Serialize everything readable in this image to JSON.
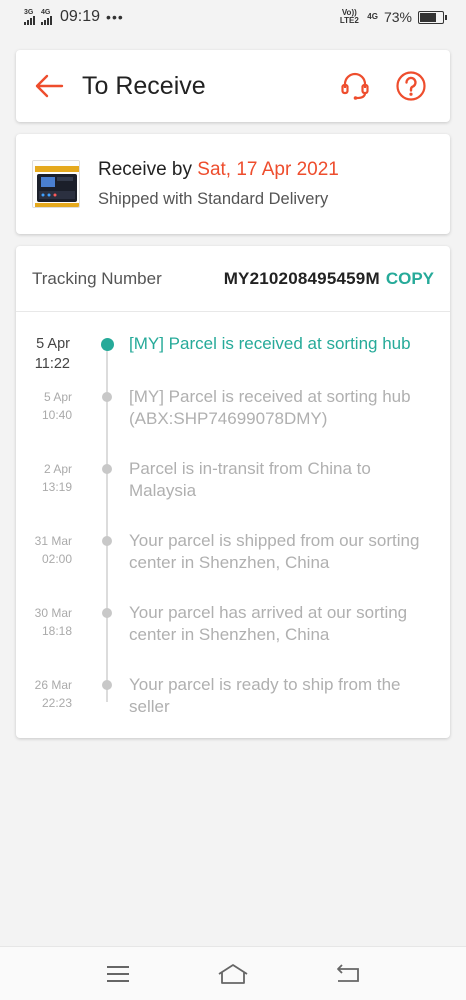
{
  "status_bar": {
    "net1": "3G",
    "net2": "4G",
    "time": "09:19",
    "dots": "•••",
    "volte": "Vo)) LTE2",
    "net3": "4G",
    "battery": "73%",
    "battery_level": 0.73
  },
  "header": {
    "title": "To Receive",
    "back_icon": "arrow-left-icon",
    "support_icon": "headset-icon",
    "help_icon": "question-icon"
  },
  "delivery": {
    "receive_by_label": "Receive by",
    "receive_date": "Sat, 17 Apr 2021",
    "shipping_method": "Shipped with Standard Delivery"
  },
  "tracking": {
    "label": "Tracking Number",
    "number": "MY210208495459M",
    "copy_label": "COPY",
    "events": [
      {
        "date": "5 Apr",
        "time": "11:22",
        "description": "[MY] Parcel is received at sorting hub",
        "active": true
      },
      {
        "date": "5 Apr",
        "time": "10:40",
        "description": "[MY] Parcel is received at sorting hub (ABX:SHP74699078DMY)",
        "active": false
      },
      {
        "date": "2 Apr",
        "time": "13:19",
        "description": "Parcel is in-transit from China to Malaysia",
        "active": false
      },
      {
        "date": "31 Mar",
        "time": "02:00",
        "description": "Your parcel is shipped from our sorting center in Shenzhen, China",
        "active": false
      },
      {
        "date": "30 Mar",
        "time": "18:18",
        "description": "Your parcel has arrived at our sorting center in Shenzhen, China",
        "active": false
      },
      {
        "date": "26 Mar",
        "time": "22:23",
        "description": "Your parcel is ready to ship from the seller",
        "active": false
      }
    ]
  },
  "colors": {
    "accent": "#ee4d2d",
    "teal": "#26aa99"
  }
}
